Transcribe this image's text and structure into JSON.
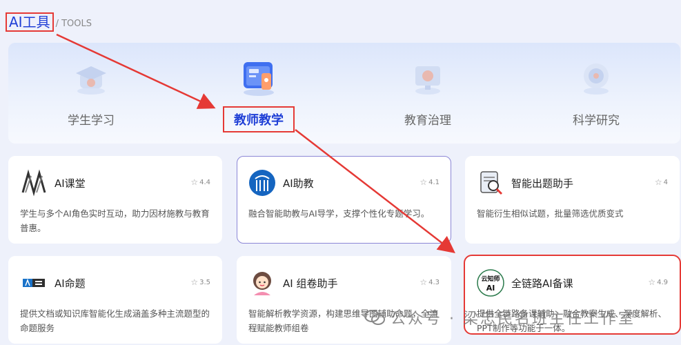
{
  "header": {
    "title": "AI工具",
    "subtitle": "/ TOOLS"
  },
  "categories": [
    {
      "label": "学生学习",
      "icon": "graduation-cap-icon",
      "active": false
    },
    {
      "label": "教师教学",
      "icon": "teacher-screen-icon",
      "active": true
    },
    {
      "label": "教育治理",
      "icon": "cloud-monitor-icon",
      "active": false
    },
    {
      "label": "科学研究",
      "icon": "brain-icon",
      "active": false
    }
  ],
  "tools": [
    {
      "name": "AI课堂",
      "rating": "4.4",
      "desc": "学生与多个AI角色实时互动，助力因材施教与教育普惠。",
      "icon": "ai-classroom-logo"
    },
    {
      "name": "AI助教",
      "rating": "4.1",
      "desc": "融合智能助教与AI导学，支撑个性化专题学习。",
      "icon": "ai-assistant-logo"
    },
    {
      "name": "智能出题助手",
      "rating": "4",
      "desc": "智能衍生相似试题，批量筛选优质变式",
      "icon": "question-magnifier-logo"
    },
    {
      "name": "AI命题",
      "rating": "3.5",
      "desc": "提供文档或知识库智能化生成涵盖多种主流题型的命题服务",
      "icon": "ai-proposition-logo"
    },
    {
      "name": "AI 组卷助手",
      "rating": "4.3",
      "desc": "智能解析教学资源，构建思维导图辅助命题，全流程赋能教师组卷",
      "icon": "teacher-avatar-logo"
    },
    {
      "name": "全链路AI备课",
      "rating": "4.9",
      "desc": "提供全链路备课辅助，融合教案生成、深度解析、PPT制作等功能于一体。",
      "icon": "yunzhishi-ai-logo",
      "logo_text": [
        "云知师",
        "AI"
      ]
    }
  ],
  "watermark": {
    "text": "公众号 · 梁忠民名班主任工作室",
    "icon": "wechat-icon"
  },
  "colors": {
    "accent": "#1f3fd6",
    "highlight": "#e53935",
    "selected_border": "#8b86d6"
  }
}
